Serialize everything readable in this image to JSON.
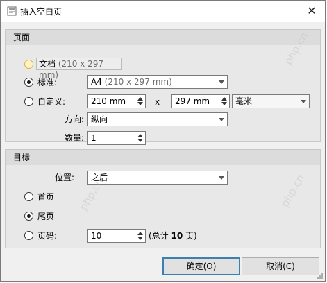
{
  "window": {
    "title": "插入空白页",
    "close_glyph": "✕"
  },
  "page_group": {
    "title": "页面",
    "document_option": {
      "label": "文档",
      "size": "(210 x 297 mm)"
    },
    "standard_option": {
      "label": "标准:",
      "paper": "A4",
      "paper_size": "(210 x 297 mm)"
    },
    "custom_option": {
      "label": "自定义:",
      "width": "210 mm",
      "times": "x",
      "height": "297 mm",
      "unit": "毫米"
    },
    "orientation": {
      "label": "方向:",
      "value": "纵向"
    },
    "quantity": {
      "label": "数量:",
      "value": "1"
    }
  },
  "target_group": {
    "title": "目标",
    "position": {
      "label": "位置:",
      "value": "之后"
    },
    "first_page": {
      "label": "首页"
    },
    "last_page": {
      "label": "尾页"
    },
    "page_number": {
      "label": "页码:",
      "value": "10",
      "total_prefix": "(总计",
      "total": "10",
      "total_suffix": "页)"
    }
  },
  "buttons": {
    "ok": "确定(O)",
    "cancel": "取消(C)"
  },
  "watermark": "php.cn",
  "colors": {
    "accent": "#3c7fb1",
    "disabled_radio": "#e0b030"
  }
}
